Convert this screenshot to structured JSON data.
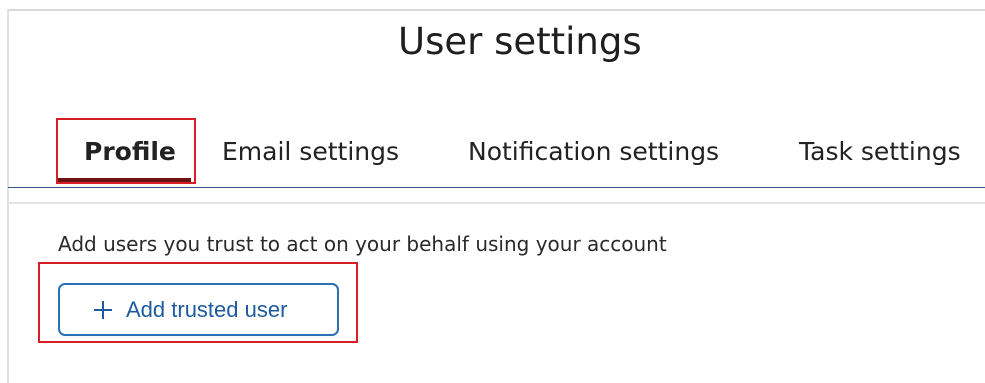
{
  "page": {
    "title": "User settings"
  },
  "tabs": [
    {
      "label": "Profile",
      "active": true
    },
    {
      "label": "Email settings",
      "active": false
    },
    {
      "label": "Notification settings",
      "active": false
    },
    {
      "label": "Task settings",
      "active": false
    }
  ],
  "profile": {
    "description": "Add users you trust to act on your behalf using your account",
    "add_button_label": "Add trusted user",
    "add_button_icon": "plus-icon"
  },
  "colors": {
    "accent_blue": "#1e5aa0",
    "annotation_red": "#d81f26",
    "active_tab_underline": "#6b1212"
  }
}
